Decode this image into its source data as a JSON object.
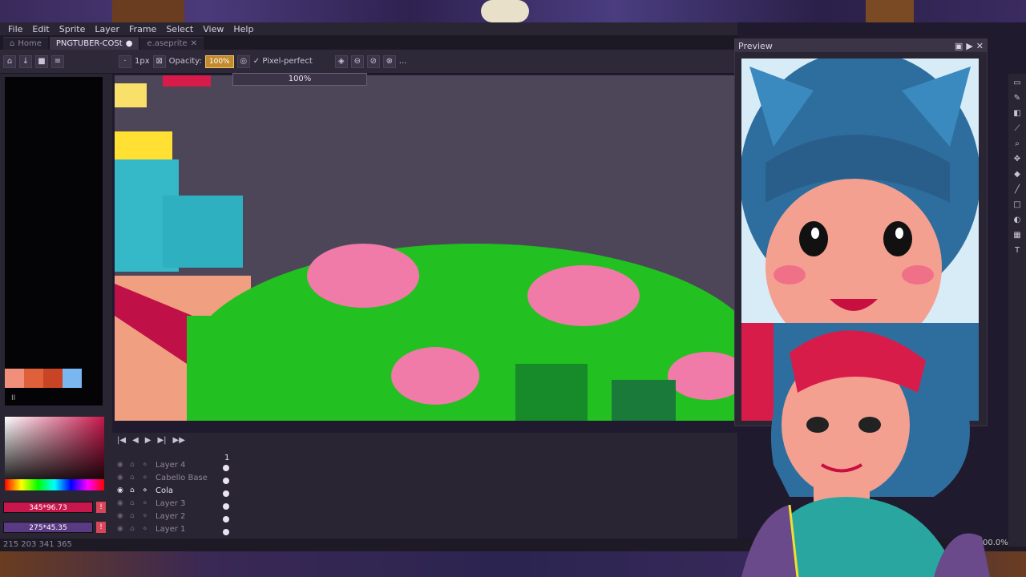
{
  "menu": [
    "File",
    "Edit",
    "Sprite",
    "Layer",
    "Frame",
    "Select",
    "View",
    "Help"
  ],
  "tabs": [
    {
      "label": "Home",
      "active": false
    },
    {
      "label": "PNGTUBER-COSt",
      "active": true
    },
    {
      "label": "e.aseprite",
      "active": false
    }
  ],
  "toolbar": {
    "brush_size": "1px",
    "opacity_label": "Opacity:",
    "opacity_value": "100%",
    "pixel_perfect_label": "Pixel-perfect",
    "more": "..."
  },
  "opacity_dropdown": "100%",
  "color_fields": {
    "fg": "345*96.73",
    "bg": "275*45.35",
    "warn": "!"
  },
  "swatch_colors": [
    "#f0907a",
    "#e0603a",
    "#c84424",
    "#7ab6f0"
  ],
  "palette_indicator": "II",
  "timeline": {
    "frame_number": "1",
    "layers": [
      {
        "name": "Layer 4",
        "active": false
      },
      {
        "name": "Cabello Base",
        "active": false
      },
      {
        "name": "Cola",
        "active": true
      },
      {
        "name": "Layer 3",
        "active": false
      },
      {
        "name": "Layer 2",
        "active": false
      },
      {
        "name": "Layer 1",
        "active": false
      }
    ]
  },
  "preview": {
    "title": "Preview"
  },
  "status": {
    "text": "215 203  341 365",
    "zoom": "00.0%"
  },
  "colors": {
    "accent": "#c38a2e",
    "selection": "#c8174c"
  }
}
